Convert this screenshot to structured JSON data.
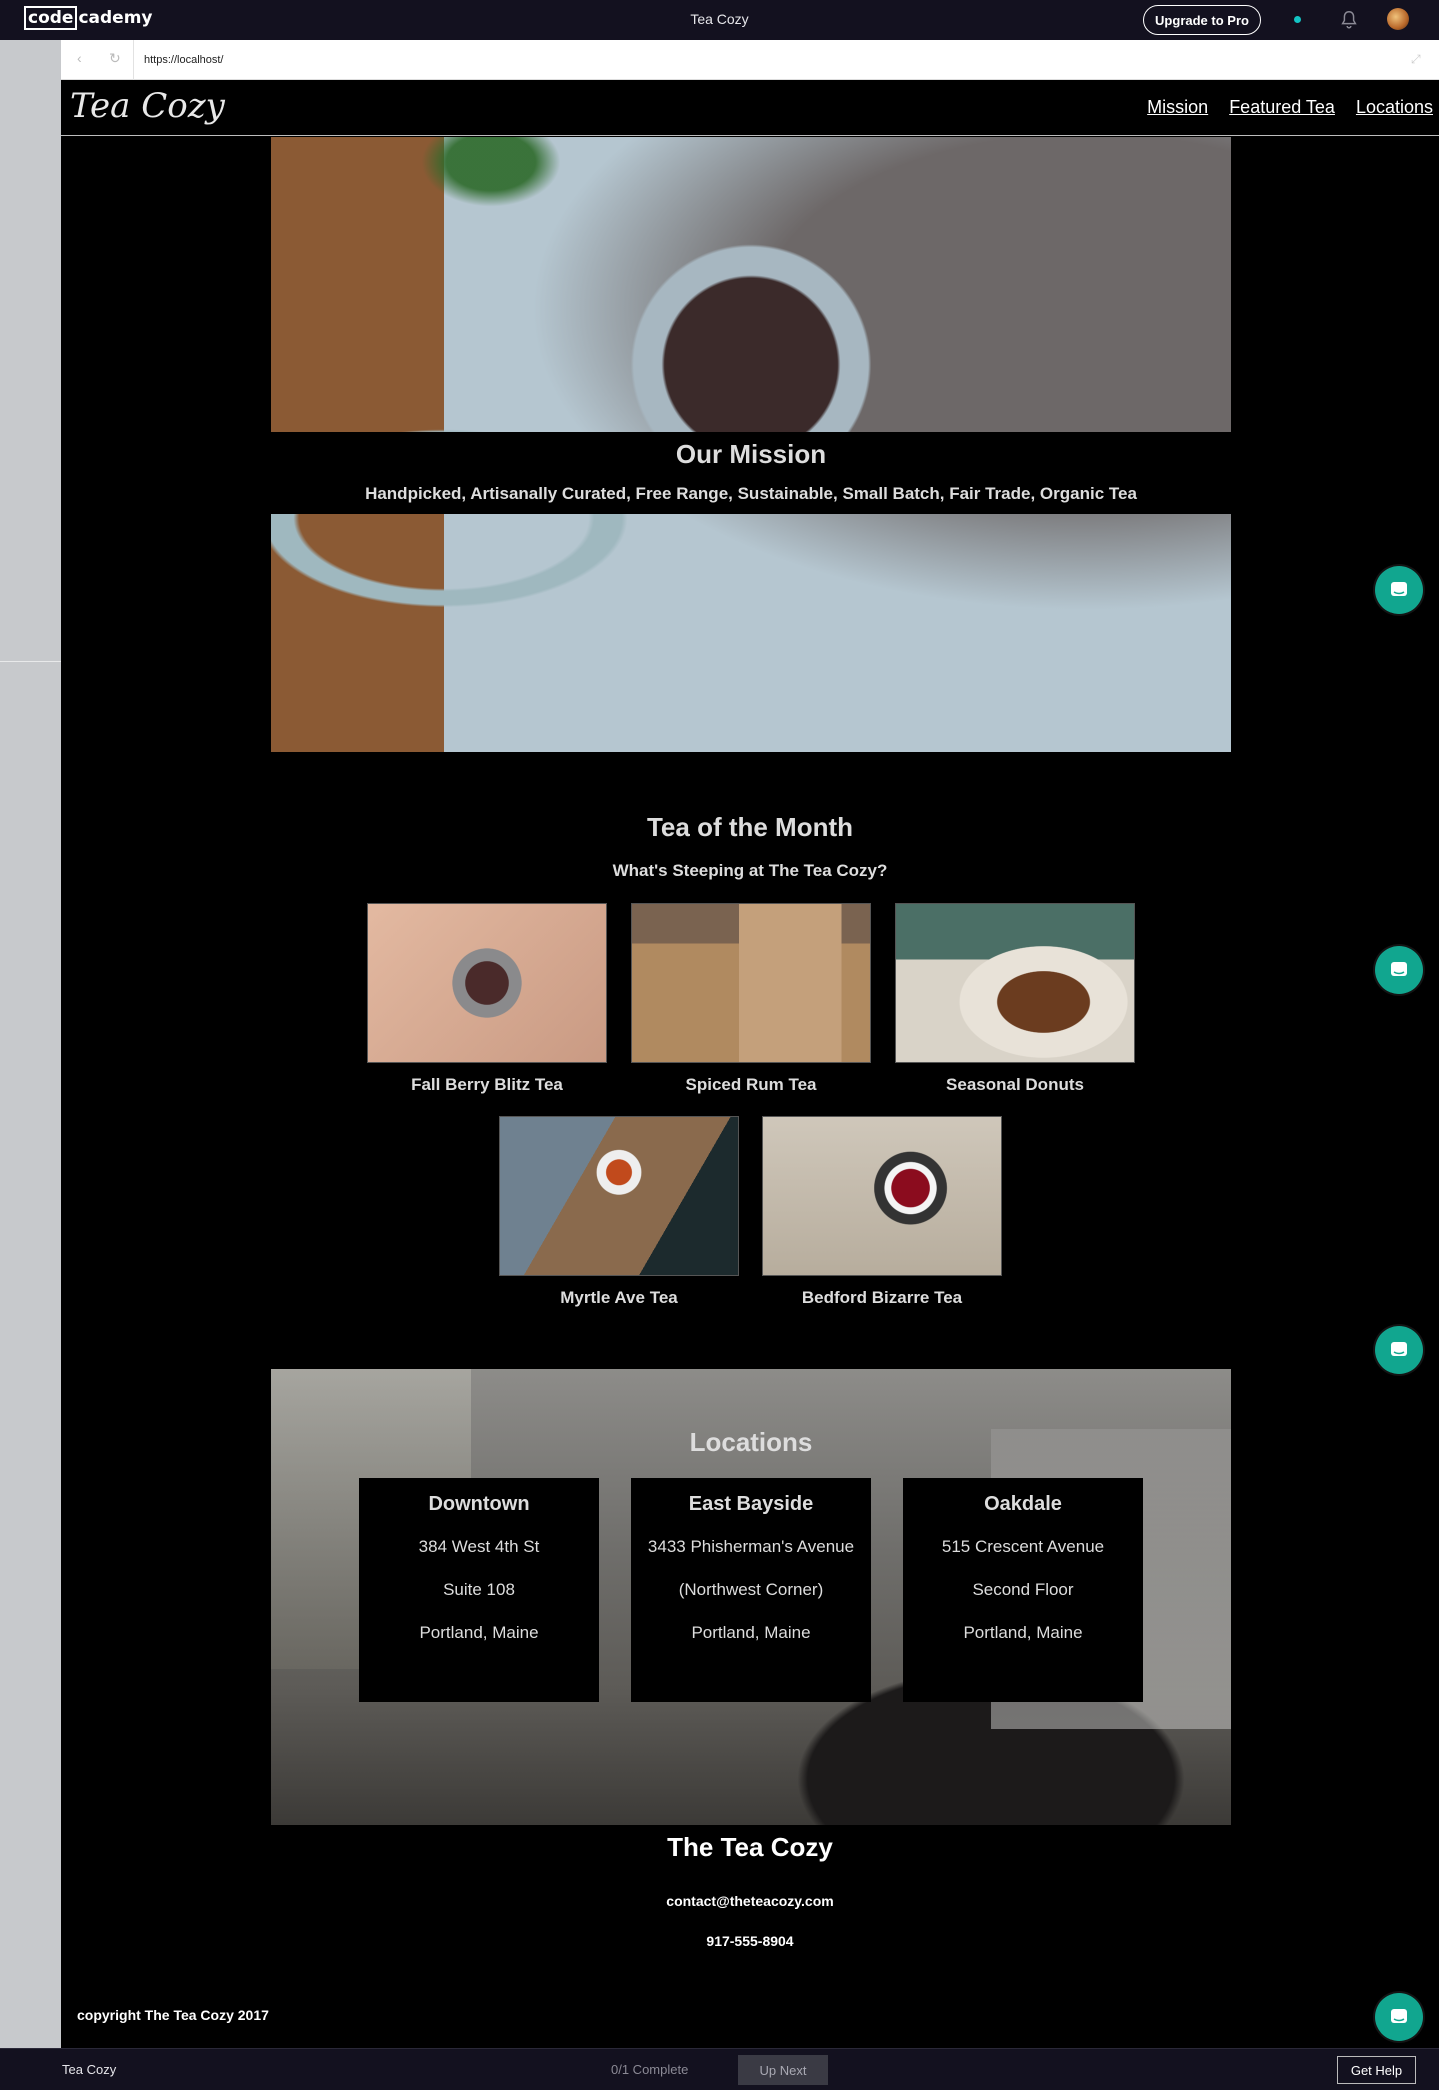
{
  "codecademy": {
    "logo_code": "code",
    "logo_rest": "cademy",
    "title": "Tea Cozy",
    "upgrade_label": "Upgrade to Pro"
  },
  "browser": {
    "url": "https://localhost/"
  },
  "site": {
    "brand": "Tea Cozy",
    "nav": [
      "Mission",
      "Featured Tea",
      "Locations"
    ],
    "mission": {
      "title": "Our Mission",
      "tagline": "Handpicked, Artisanally Curated, Free Range, Sustainable, Small Batch, Fair Trade, Organic Tea"
    },
    "featured": {
      "title": "Tea of the Month",
      "subtitle": "What's Steeping at The Tea Cozy?",
      "items": [
        {
          "name": "Fall Berry Blitz Tea"
        },
        {
          "name": "Spiced Rum Tea"
        },
        {
          "name": "Seasonal Donuts"
        },
        {
          "name": "Myrtle Ave Tea"
        },
        {
          "name": "Bedford Bizarre Tea"
        }
      ]
    },
    "locations": {
      "title": "Locations",
      "cards": [
        {
          "name": "Downtown",
          "line1": "384 West 4th St",
          "line2": "Suite 108",
          "line3": "Portland, Maine"
        },
        {
          "name": "East Bayside",
          "line1": "3433 Phisherman's Avenue",
          "line2": "(Northwest Corner)",
          "line3": "Portland, Maine"
        },
        {
          "name": "Oakdale",
          "line1": "515 Crescent Avenue",
          "line2": "Second Floor",
          "line3": "Portland, Maine"
        }
      ]
    },
    "footer": {
      "name": "The Tea Cozy",
      "email": "contact@theteacozy.com",
      "phone": "917-555-8904",
      "copyright": "copyright The Tea Cozy 2017"
    }
  },
  "bottom_bar": {
    "project": "Tea Cozy",
    "progress": "0/1 Complete",
    "up_next": "Up Next",
    "help": "Get Help"
  },
  "icons": {
    "chat": "chat-bubble-icon",
    "bell": "bell-icon",
    "back": "back-arrow-icon",
    "reload": "reload-icon",
    "expand": "expand-icon"
  },
  "colors": {
    "codecademy_bar": "#13111f",
    "chat_accent": "#11a68f",
    "status_dot": "#13c4c4",
    "page_bg": "#000000"
  }
}
